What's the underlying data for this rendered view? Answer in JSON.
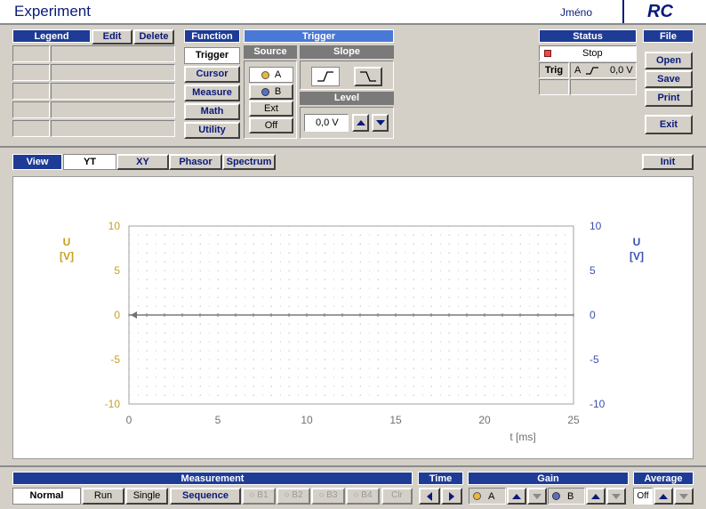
{
  "header": {
    "title": "Experiment",
    "user": "Jméno",
    "logo": "RC"
  },
  "legend": {
    "title": "Legend",
    "edit": "Edit",
    "delete": "Delete"
  },
  "function": {
    "title": "Function",
    "items": [
      "Trigger",
      "Cursor",
      "Measure",
      "Math",
      "Utility"
    ],
    "active": "Trigger"
  },
  "trigger": {
    "title": "Trigger",
    "source_title": "Source",
    "sources": [
      "A",
      "B",
      "Ext",
      "Off"
    ],
    "slope_title": "Slope",
    "level_title": "Level",
    "level_value": "0,0 V"
  },
  "status": {
    "title": "Status",
    "state": "Stop",
    "trig_label": "Trig",
    "trig_channel": "A",
    "trig_value": "0,0 V"
  },
  "file": {
    "title": "File",
    "open": "Open",
    "save": "Save",
    "print": "Print",
    "exit": "Exit"
  },
  "view": {
    "label": "View",
    "tabs": [
      "YT",
      "XY",
      "Phasor",
      "Spectrum"
    ],
    "active": "YT",
    "init": "Init"
  },
  "chart_data": {
    "type": "line",
    "title": "",
    "xlabel": "t [ms]",
    "ylabel_left": "U\n[V]",
    "ylabel_right": "U\n[V]",
    "xlim": [
      0,
      25
    ],
    "ylim": [
      -10,
      10
    ],
    "x_ticks": [
      "0",
      "5",
      "10",
      "15",
      "20",
      "25"
    ],
    "y_ticks": [
      "10",
      "5",
      "0",
      "-5",
      "-10"
    ],
    "grid": true,
    "series": [],
    "trigger_marker_y": 0
  },
  "colors": {
    "channelA": "#c8a020",
    "channelB": "#3a4fb0",
    "navy": "#1e3c96"
  },
  "bottom": {
    "measurement_title": "Measurement",
    "modes": [
      "Normal",
      "Run",
      "Single",
      "Sequence"
    ],
    "active_mode": "Normal",
    "markers": [
      "B1",
      "B2",
      "B3",
      "B4"
    ],
    "clear": "Clr",
    "time_title": "Time",
    "gain_title": "Gain",
    "gain_a": "A",
    "gain_b": "B",
    "average_title": "Average",
    "average_value": "Off"
  }
}
